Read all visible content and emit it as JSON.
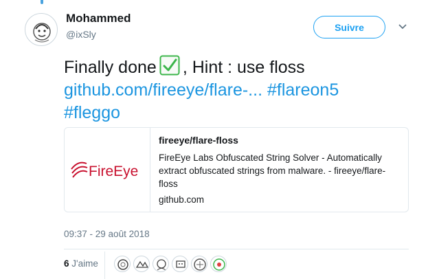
{
  "author": {
    "display_name": "Mohammed",
    "handle": "@ixSly",
    "avatar_icon": "avatar-sketch-icon"
  },
  "follow_button": {
    "label": "Suivre"
  },
  "menu_icon": "chevron-down-icon",
  "tweet": {
    "text_part1": "Finally done",
    "emoji": "white-heavy-check-mark-icon",
    "text_part2": ", Hint : use floss",
    "link": "github.com/fireeye/flare-...",
    "hashtag1": "#flareon5",
    "hashtag2": "#fleggo"
  },
  "card": {
    "logo_text": "FireEye",
    "title": "fireeye/flare-floss",
    "description": "FireEye Labs Obfuscated String Solver - Automatically extract obfuscated strings from malware. - fireeye/flare-floss",
    "domain": "github.com"
  },
  "timestamp": "09:37 - 29 août 2018",
  "likes": {
    "count": "6",
    "label": "J'aime"
  },
  "colors": {
    "link": "#1b95e0",
    "follow_border": "#1da1f2",
    "logo_red": "#c8102e",
    "check_green": "#3bb54a"
  }
}
